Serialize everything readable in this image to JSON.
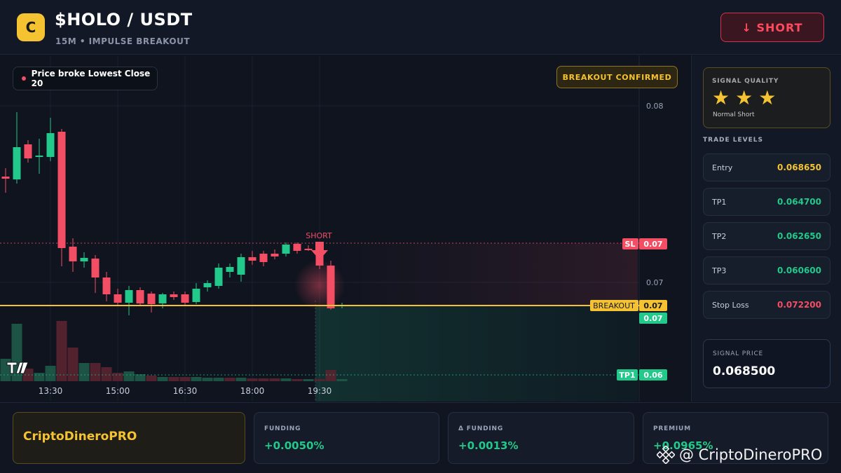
{
  "header": {
    "logo_letter": "C",
    "pair": "$HOLO / USDT",
    "subtitle": "15M • IMPULSE BREAKOUT",
    "short_button": "↓ SHORT"
  },
  "chart": {
    "notice": "Price broke Lowest Close 20",
    "badge": "BREAKOUT CONFIRMED",
    "signal_marker": "SHORT",
    "y_ticks": [
      "0.08",
      "0.07"
    ],
    "x_ticks": [
      "13:30",
      "15:00",
      "16:30",
      "18:00",
      "19:30"
    ],
    "tags": {
      "sl": {
        "label": "SL",
        "value": "0.07"
      },
      "breakout": {
        "label": "BREAKOUT",
        "value": "0.07"
      },
      "last": {
        "value": "0.07"
      },
      "tp1": {
        "label": "TP1",
        "value": "0.06"
      }
    },
    "colors": {
      "up": "#22c98a",
      "down": "#f34e63",
      "breakout": "#f5c331"
    }
  },
  "chart_data": {
    "type": "candlestick",
    "x_labels": [
      "13:30",
      "15:00",
      "16:30",
      "18:00",
      "19:30"
    ],
    "y_ticks": [
      0.08,
      0.07
    ],
    "candles": [
      {
        "o": 252,
        "c": 255,
        "h": 240,
        "l": 275
      },
      {
        "o": 256,
        "c": 210,
        "h": 160,
        "l": 262
      },
      {
        "o": 206,
        "c": 226,
        "h": 200,
        "l": 232
      },
      {
        "o": 224,
        "c": 222,
        "h": 198,
        "l": 248
      },
      {
        "o": 224,
        "c": 190,
        "h": 168,
        "l": 230
      },
      {
        "o": 188,
        "c": 354,
        "h": 184,
        "l": 380
      },
      {
        "o": 352,
        "c": 373,
        "h": 340,
        "l": 388
      },
      {
        "o": 373,
        "c": 368,
        "h": 360,
        "l": 382
      },
      {
        "o": 369,
        "c": 396,
        "h": 364,
        "l": 418
      },
      {
        "o": 396,
        "c": 420,
        "h": 388,
        "l": 430
      },
      {
        "o": 420,
        "c": 432,
        "h": 412,
        "l": 436
      },
      {
        "o": 432,
        "c": 414,
        "h": 408,
        "l": 450
      },
      {
        "o": 414,
        "c": 433,
        "h": 410,
        "l": 436
      },
      {
        "o": 419,
        "c": 434,
        "h": 416,
        "l": 446
      },
      {
        "o": 433,
        "c": 420,
        "h": 418,
        "l": 440
      },
      {
        "o": 420,
        "c": 424,
        "h": 416,
        "l": 428
      },
      {
        "o": 420,
        "c": 432,
        "h": 416,
        "l": 437
      },
      {
        "o": 431,
        "c": 412,
        "h": 404,
        "l": 434
      },
      {
        "o": 410,
        "c": 404,
        "h": 400,
        "l": 416
      },
      {
        "o": 408,
        "c": 382,
        "h": 376,
        "l": 412
      },
      {
        "o": 388,
        "c": 381,
        "h": 376,
        "l": 396
      },
      {
        "o": 392,
        "c": 367,
        "h": 362,
        "l": 402
      },
      {
        "o": 367,
        "c": 372,
        "h": 358,
        "l": 378
      },
      {
        "o": 362,
        "c": 374,
        "h": 358,
        "l": 380
      },
      {
        "o": 362,
        "c": 366,
        "h": 356,
        "l": 370
      },
      {
        "o": 362,
        "c": 349,
        "h": 346,
        "l": 366
      },
      {
        "o": 348,
        "c": 358,
        "h": 346,
        "l": 362
      },
      {
        "o": 355,
        "c": 355,
        "h": 350,
        "l": 358
      },
      {
        "o": 354,
        "c": 379,
        "h": 350,
        "l": 384
      },
      {
        "o": 379,
        "c": 440,
        "h": 372,
        "l": 442
      },
      {
        "o": 437,
        "c": 435,
        "h": 432,
        "l": 440
      }
    ],
    "volumes": [
      {
        "v": 32,
        "up": true
      },
      {
        "v": 82,
        "up": true
      },
      {
        "v": 18,
        "up": false
      },
      {
        "v": 12,
        "up": true
      },
      {
        "v": 22,
        "up": true
      },
      {
        "v": 86,
        "up": false
      },
      {
        "v": 48,
        "up": false
      },
      {
        "v": 26,
        "up": true
      },
      {
        "v": 26,
        "up": false
      },
      {
        "v": 20,
        "up": false
      },
      {
        "v": 12,
        "up": false
      },
      {
        "v": 14,
        "up": true
      },
      {
        "v": 10,
        "up": true
      },
      {
        "v": 8,
        "up": false
      },
      {
        "v": 6,
        "up": true
      },
      {
        "v": 6,
        "up": false
      },
      {
        "v": 6,
        "up": false
      },
      {
        "v": 6,
        "up": true
      },
      {
        "v": 5,
        "up": true
      },
      {
        "v": 5,
        "up": true
      },
      {
        "v": 5,
        "up": false
      },
      {
        "v": 5,
        "up": true
      },
      {
        "v": 4,
        "up": false
      },
      {
        "v": 4,
        "up": false
      },
      {
        "v": 4,
        "up": false
      },
      {
        "v": 4,
        "up": true
      },
      {
        "v": 3,
        "up": false
      },
      {
        "v": 3,
        "up": true
      },
      {
        "v": 3,
        "up": false
      },
      {
        "v": 16,
        "up": false
      },
      {
        "v": 3,
        "up": true
      }
    ]
  },
  "panel": {
    "quality_label": "SIGNAL QUALITY",
    "stars": 3,
    "quality_note": "Normal Short",
    "levels_title": "TRADE LEVELS",
    "levels": [
      {
        "name": "Entry",
        "value": "0.068650",
        "color": "#f5c331"
      },
      {
        "name": "TP1",
        "value": "0.064700",
        "color": "#22c98a"
      },
      {
        "name": "TP2",
        "value": "0.062650",
        "color": "#22c98a"
      },
      {
        "name": "TP3",
        "value": "0.060600",
        "color": "#22c98a"
      },
      {
        "name": "Stop Loss",
        "value": "0.072200",
        "color": "#f34e63"
      }
    ],
    "signal_price_label": "SIGNAL PRICE",
    "signal_price": "0.068500"
  },
  "bottom": {
    "brand": "CriptoDineroPRO",
    "metrics": [
      {
        "label": "FUNDING",
        "value": "+0.0050%"
      },
      {
        "label": "Δ FUNDING",
        "value": "+0.0013%"
      },
      {
        "label": "PREMIUM",
        "value": "+0.0965%"
      }
    ],
    "watermark": "@ CriptoDineroPRO"
  }
}
